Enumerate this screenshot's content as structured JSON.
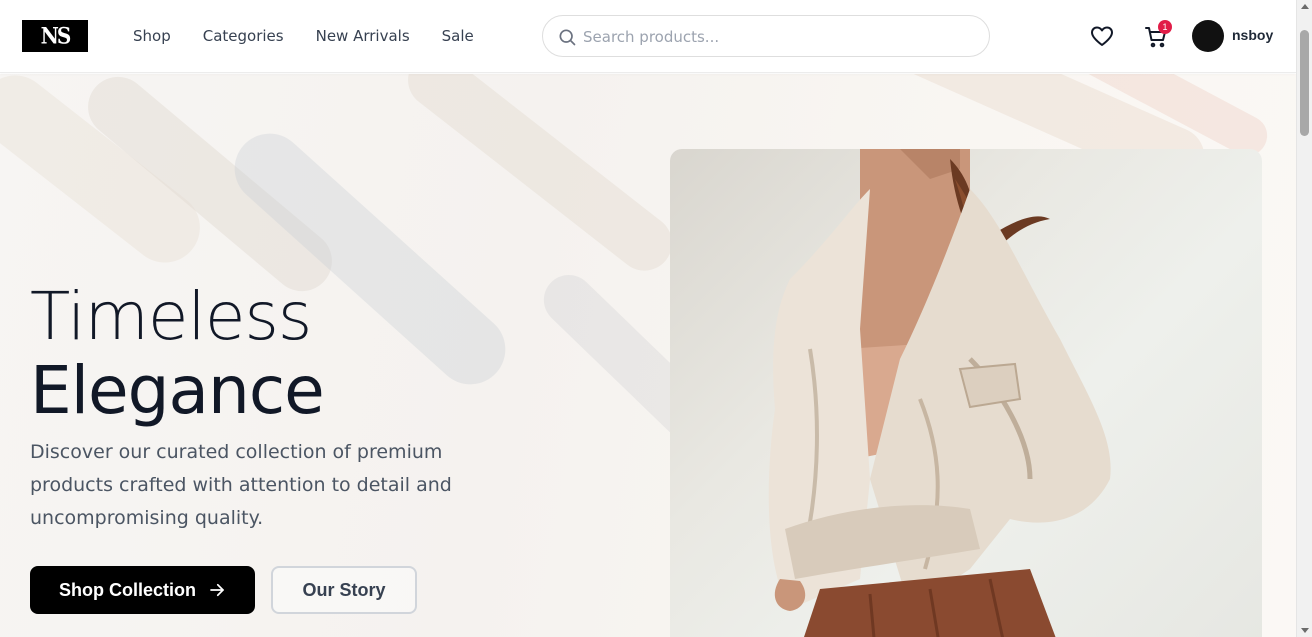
{
  "header": {
    "logo_text": "NS",
    "nav": [
      "Shop",
      "Categories",
      "New Arrivals",
      "Sale"
    ],
    "search_placeholder": "Search products...",
    "cart_count": "1",
    "username": "nsboy"
  },
  "hero": {
    "title_light": "Timeless",
    "title_bold": "Elegance",
    "description": "Discover our curated collection of premium products crafted with attention to detail and uncompromising quality.",
    "primary_button": "Shop Collection",
    "secondary_button": "Our Story"
  },
  "colors": {
    "badge": "#e11d48",
    "primary_button_bg": "#000000",
    "title": "#111827"
  },
  "icons": {
    "search": "search-icon",
    "wishlist": "heart-icon",
    "cart": "cart-icon",
    "button_arrow": "arrow-right-icon"
  }
}
